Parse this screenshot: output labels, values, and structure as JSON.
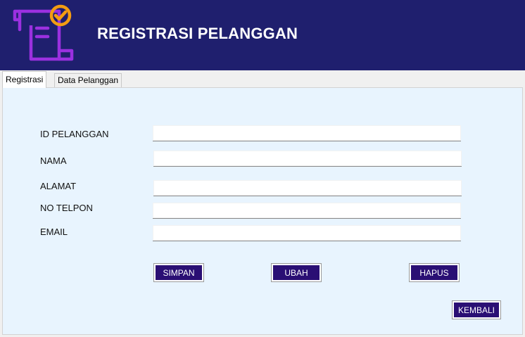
{
  "header": {
    "title": "REGISTRASI PELANGGAN",
    "logo_icon": "checklist-scroll-icon",
    "bg_color": "#1f1f6e",
    "logo_color": "#9b30e0",
    "check_color": "#f39c12"
  },
  "tabs": [
    {
      "label": "Registrasi",
      "active": true
    },
    {
      "label": "Data Pelanggan",
      "active": false
    }
  ],
  "form": {
    "fields": [
      {
        "label": "ID PELANGGAN",
        "value": ""
      },
      {
        "label": "NAMA",
        "value": ""
      },
      {
        "label": "ALAMAT",
        "value": ""
      },
      {
        "label": "NO TELPON",
        "value": ""
      },
      {
        "label": "EMAIL",
        "value": ""
      }
    ]
  },
  "buttons": {
    "simpan": "SIMPAN",
    "ubah": "UBAH",
    "hapus": "HAPUS",
    "kembali": "KEMBALI",
    "color": "#2a0f74"
  },
  "panel_color": "#e8f4fe"
}
